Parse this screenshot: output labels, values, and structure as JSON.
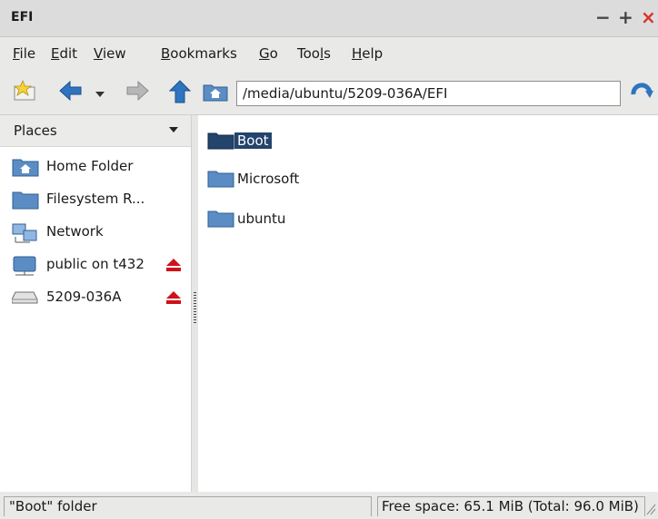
{
  "window": {
    "title": "EFI",
    "controls": [
      "−",
      "+",
      "×"
    ]
  },
  "menubar": [
    {
      "mnemonic": "F",
      "rest": "ile"
    },
    {
      "mnemonic": "E",
      "rest": "dit"
    },
    {
      "mnemonic": "V",
      "rest": "iew"
    },
    {
      "mnemonic": "B",
      "rest": "ookmarks"
    },
    {
      "mnemonic": "G",
      "rest": "o"
    },
    {
      "pre": "Too",
      "mnemonic": "l",
      "rest": "s"
    },
    {
      "mnemonic": "H",
      "rest": "elp"
    }
  ],
  "toolbar": {
    "icons": [
      "new-tab-icon",
      "back-arrow-icon",
      "history-dropdown-icon",
      "forward-arrow-icon",
      "up-arrow-icon",
      "home-icon",
      "reload-icon"
    ],
    "location": "/media/ubuntu/5209-036A/EFI"
  },
  "sidebar": {
    "header": "Places",
    "items": [
      {
        "label": "Home Folder",
        "icon": "home-folder-icon"
      },
      {
        "label": "Filesystem R...",
        "icon": "folder-icon"
      },
      {
        "label": "Network",
        "icon": "network-icon"
      },
      {
        "label": "public on t432",
        "icon": "network-drive-icon",
        "eject": true
      },
      {
        "label": "5209-036A",
        "icon": "usb-drive-icon",
        "eject": true
      }
    ]
  },
  "files": [
    {
      "name": "Boot",
      "selected": true
    },
    {
      "name": "Microsoft",
      "selected": false
    },
    {
      "name": "ubuntu",
      "selected": false
    }
  ],
  "status": {
    "left": "\"Boot\" folder",
    "right": "Free space: 65.1 MiB (Total: 96.0 MiB)"
  },
  "colors": {
    "selection": "#23446d",
    "folder": "#5b8dc4",
    "eject": "#d0101a",
    "arrow": "#2f74c0"
  }
}
